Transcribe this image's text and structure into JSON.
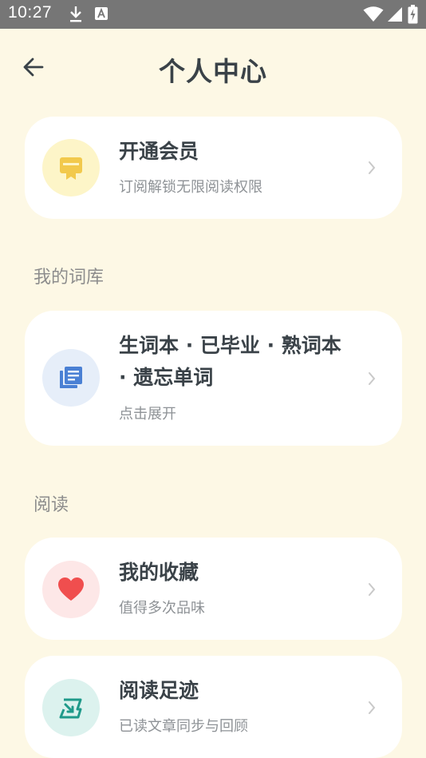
{
  "status_bar": {
    "time": "10:27",
    "icons": [
      "download-icon",
      "app-a-icon",
      "wifi-icon",
      "signal-icon",
      "battery-charging-icon"
    ]
  },
  "header": {
    "title": "个人中心",
    "back_icon": "arrow-left-icon"
  },
  "vip_card": {
    "title": "开通会员",
    "subtitle": "订阅解锁无限阅读权限",
    "icon": "membership-badge-icon",
    "icon_color": "#f2c94c",
    "icon_bg": "#fdf5c8"
  },
  "section_wordbank": {
    "label": "我的词库"
  },
  "wordbank_card": {
    "title": "生词本 · 已毕业 · 熟词本 · 遗忘单词",
    "subtitle": "点击展开",
    "icon": "word-list-icon",
    "icon_color": "#4a80d4",
    "icon_bg": "#e6eef9"
  },
  "section_reading": {
    "label": "阅读"
  },
  "favorites_card": {
    "title": "我的收藏",
    "subtitle": "值得多次品味",
    "icon": "heart-icon",
    "icon_color": "#f04e4e",
    "icon_bg": "#fde7e7"
  },
  "history_card": {
    "title": "阅读足迹",
    "subtitle": "已读文章同步与回顾",
    "icon": "reading-footprint-icon",
    "icon_color": "#1f9a8a",
    "icon_bg": "#dcf2ee"
  },
  "colors": {
    "background": "#fdf8e5",
    "card": "#ffffff",
    "title_text": "#3a4248",
    "muted_text": "#8e9296",
    "status_bar": "#767676"
  }
}
